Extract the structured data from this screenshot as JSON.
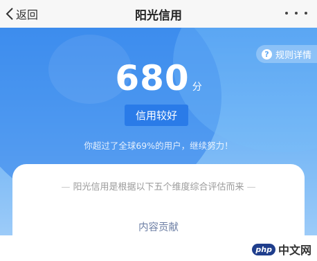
{
  "navbar": {
    "back_label": "返回",
    "title": "阳光信用",
    "more_icon": "more-dots-icon"
  },
  "hero": {
    "rules_label": "规则详情",
    "rules_icon_glyph": "?",
    "score": "680",
    "score_unit": "分",
    "level": "信用较好",
    "hint": "你超过了全球69%的用户，继续努力！",
    "colors": {
      "primary_blue": "#4b9af0",
      "badge_blue": "#2a7be8"
    }
  },
  "card": {
    "description": "阳光信用是根据以下五个维度综合评估而来",
    "dash": "—",
    "first_dimension": "内容贡献"
  },
  "watermark": {
    "badge": "php",
    "text": "中文网"
  }
}
